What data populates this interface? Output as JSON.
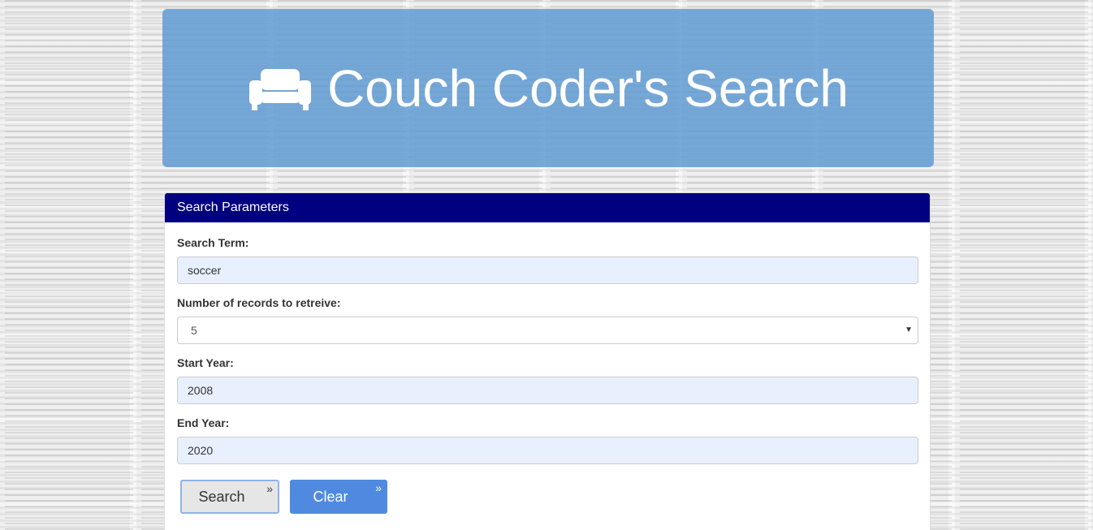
{
  "header": {
    "title": "Couch Coder's Search",
    "icon": "couch-icon"
  },
  "panel": {
    "heading": "Search Parameters",
    "fields": {
      "search_term": {
        "label": "Search Term:",
        "value": "soccer"
      },
      "num_records": {
        "label": "Number of records to retreive:",
        "value": "5"
      },
      "start_year": {
        "label": "Start Year:",
        "value": "2008"
      },
      "end_year": {
        "label": "End Year:",
        "value": "2020"
      }
    },
    "buttons": {
      "search_label": "Search",
      "clear_label": "Clear",
      "chevron": "»"
    }
  },
  "colors": {
    "header_bg": "#5c98d2",
    "panel_heading_bg": "#000080",
    "input_bg": "#e8f0fe",
    "clear_button_bg": "#4f8ae0"
  }
}
